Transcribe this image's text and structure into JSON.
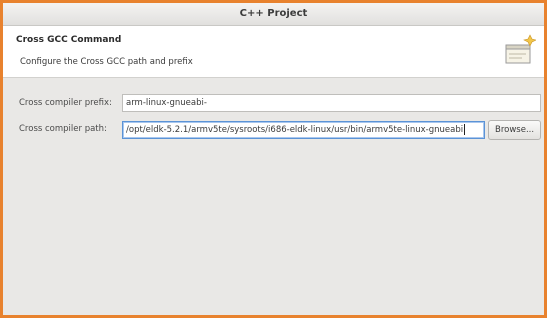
{
  "window": {
    "title": "C++ Project"
  },
  "banner": {
    "title": "Cross GCC Command",
    "description": "Configure the Cross GCC path and prefix",
    "icon": "wizard-banner-icon"
  },
  "form": {
    "prefix": {
      "label": "Cross compiler prefix:",
      "value": "arm-linux-gnueabi-"
    },
    "path": {
      "label": "Cross compiler path:",
      "value": "/opt/eldk-5.2.1/armv5te/sysroots/i686-eldk-linux/usr/bin/armv5te-linux-gnueabi",
      "browse_label": "Browse..."
    }
  },
  "colors": {
    "frame_border": "#e8822e",
    "focus_border": "#5b93d6",
    "dialog_background": "#e9e8e6"
  }
}
